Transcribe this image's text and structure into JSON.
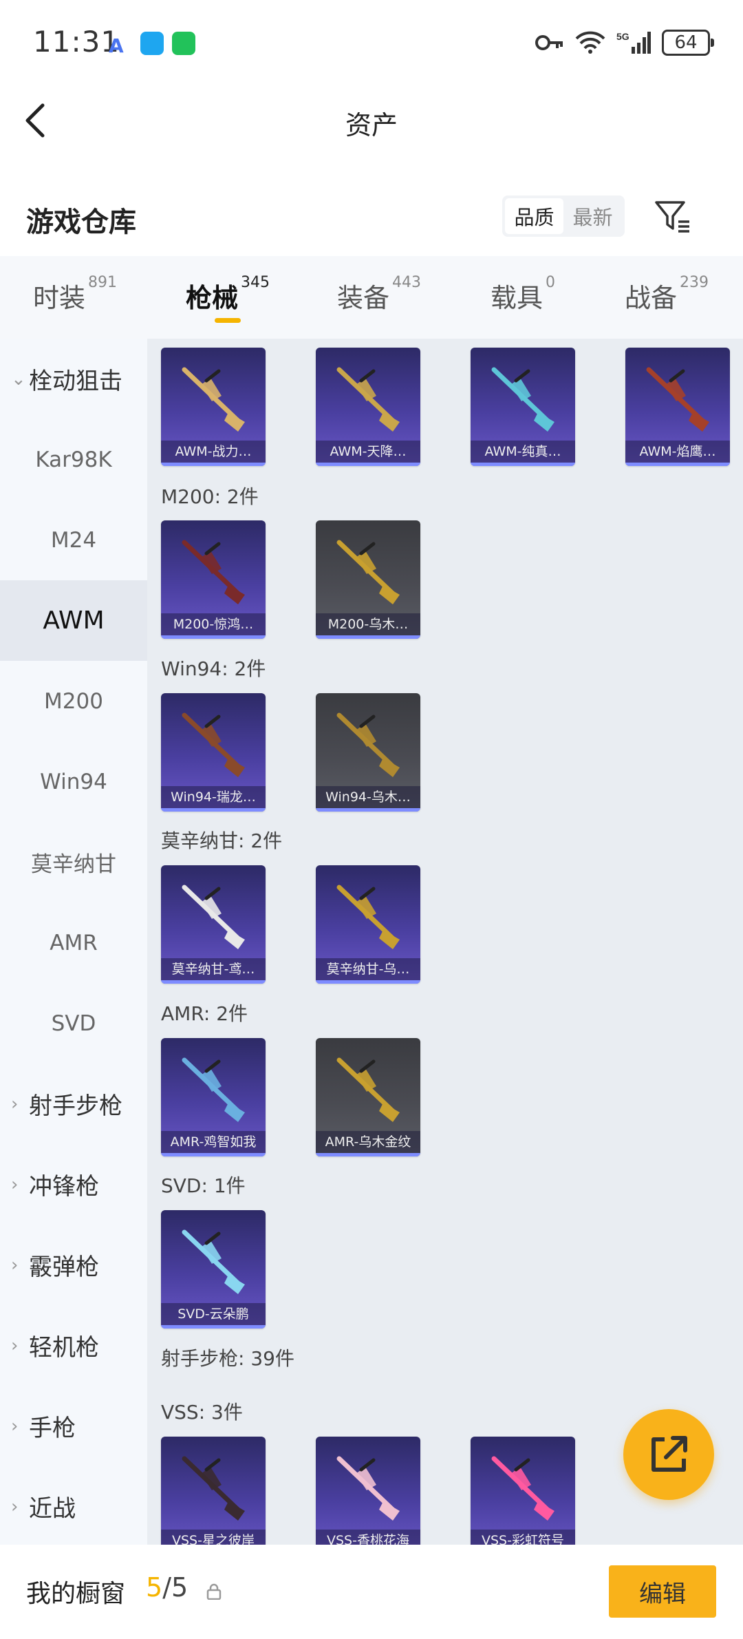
{
  "status_bar": {
    "time": "11:31",
    "battery": "64"
  },
  "header": {
    "title": "资产"
  },
  "warehouse": {
    "title": "游戏仓库",
    "sort_quality": "品质",
    "sort_latest": "最新"
  },
  "tabs": [
    {
      "label": "时装",
      "count": "891"
    },
    {
      "label": "枪械",
      "count": "345"
    },
    {
      "label": "装备",
      "count": "443"
    },
    {
      "label": "载具",
      "count": "0"
    },
    {
      "label": "战备",
      "count": "239"
    }
  ],
  "sidebar": {
    "group_sniper": "栓动狙击",
    "items": [
      "Kar98K",
      "M24",
      "AWM",
      "M200",
      "Win94",
      "莫辛纳甘",
      "AMR",
      "SVD"
    ],
    "groups": [
      "射手步枪",
      "冲锋枪",
      "霰弹枪",
      "轻机枪",
      "手枪",
      "近战"
    ]
  },
  "sections": {
    "awm_items": [
      "AWM-战力…",
      "AWM-天降…",
      "AWM-纯真…",
      "AWM-焰鹰…"
    ],
    "m200_title": "M200: 2件",
    "m200_items": [
      "M200-惊鸿…",
      "M200-乌木…"
    ],
    "win94_title": "Win94: 2件",
    "win94_items": [
      "Win94-瑞龙…",
      "Win94-乌木…"
    ],
    "mosin_title": "莫辛纳甘: 2件",
    "mosin_items": [
      "莫辛纳甘-鸢…",
      "莫辛纳甘-乌…"
    ],
    "amr_title": "AMR: 2件",
    "amr_items": [
      "AMR-鸡智如我",
      "AMR-乌木金纹"
    ],
    "svd_title": "SVD: 1件",
    "svd_items": [
      "SVD-云朵鹏"
    ],
    "dmr_title": "射手步枪: 39件",
    "vss_title": "VSS: 3件",
    "vss_items": [
      "VSS-星之彼岸",
      "VSS-香桃花海",
      "VSS-彩虹符号"
    ]
  },
  "bottom_bar": {
    "label": "我的橱窗",
    "count_current": "5",
    "count_total": "/5",
    "edit_label": "编辑"
  }
}
